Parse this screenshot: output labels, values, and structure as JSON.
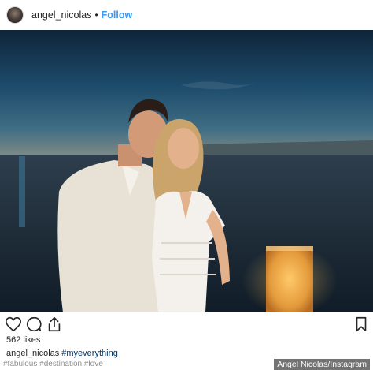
{
  "header": {
    "username": "angel_nicolas",
    "separator": "•",
    "follow_label": "Follow"
  },
  "post": {
    "photo_icon": "couple-sunset-photo",
    "likes": "562 likes",
    "caption_user": "angel_nicolas",
    "caption_hashtag": "#myeverything",
    "comments_line": "#fabulous #destination #love"
  },
  "actions": {
    "like_icon": "heart-icon",
    "comment_icon": "comment-icon",
    "share_icon": "share-icon",
    "save_icon": "bookmark-icon"
  },
  "credit": "Angel Nicolas/Instagram",
  "colors": {
    "follow": "#3897f0",
    "hashtag": "#003569",
    "text": "#262626",
    "muted": "#8e8e8e"
  }
}
